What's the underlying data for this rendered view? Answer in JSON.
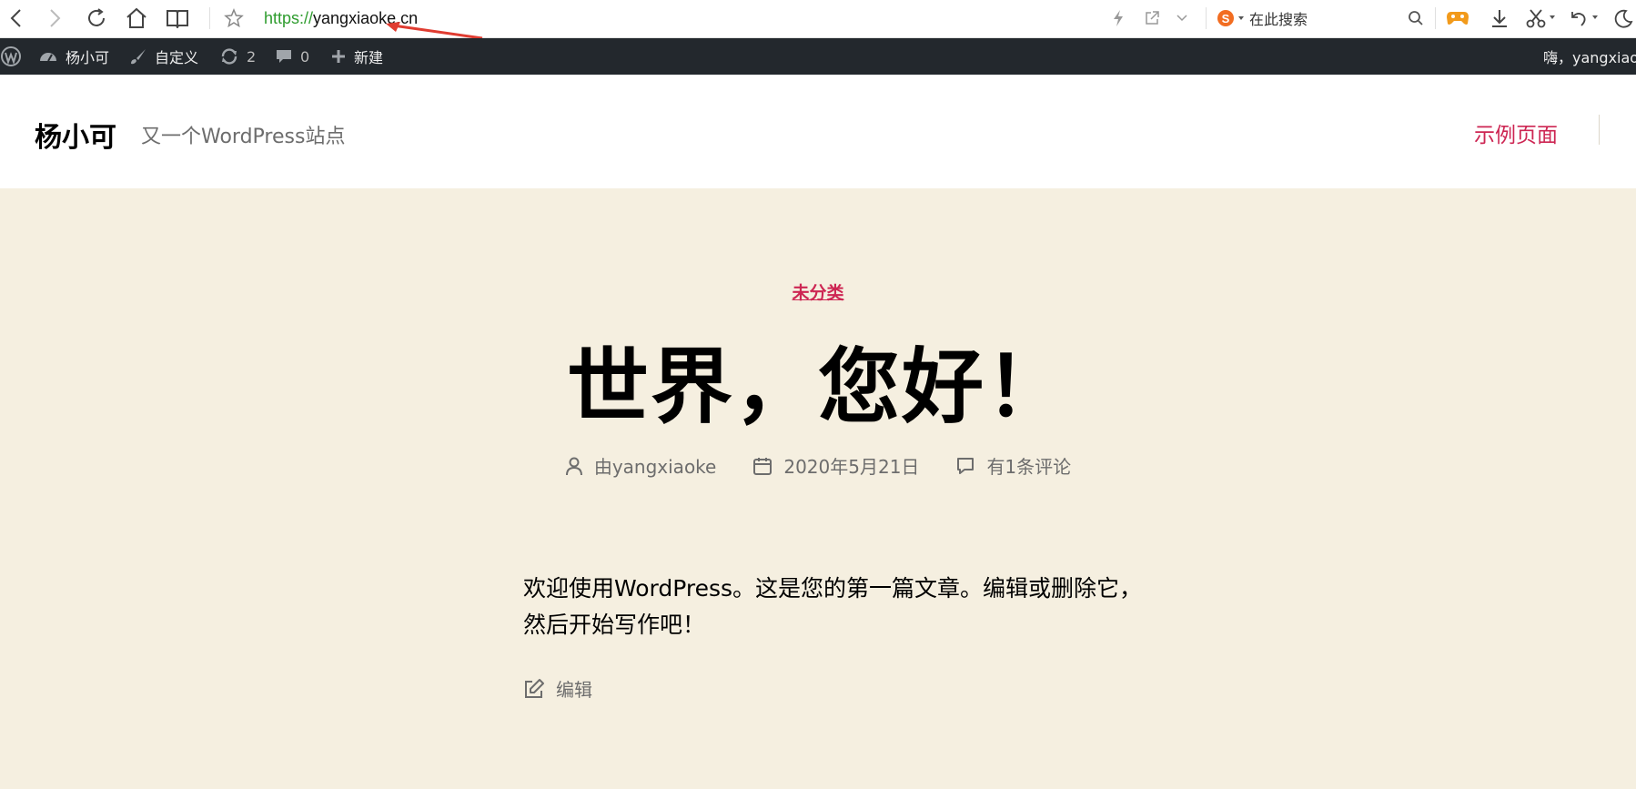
{
  "browser": {
    "url_scheme": "https://",
    "url_host": "yangxiaoke.cn",
    "search_placeholder": "在此搜索"
  },
  "admin_bar": {
    "site_name": "杨小可",
    "customize": "自定义",
    "updates_count": "2",
    "comments_count": "0",
    "new": "新建",
    "greeting": "嗨，yangxiaok"
  },
  "header": {
    "site_title": "杨小可",
    "site_description": "又一个WordPress站点",
    "menu_item": "示例页面"
  },
  "post": {
    "category": "未分类",
    "title": "世界，您好！",
    "author": "由yangxiaoke",
    "date": "2020年5月21日",
    "comments": "有1条评论",
    "content_line1": "欢迎使用WordPress。这是您的第一篇文章。编辑或删除它，",
    "content_line2": "然后开始写作吧！",
    "edit": "编辑"
  },
  "colors": {
    "accent": "#cd2653",
    "background": "#f5efe0",
    "admin_bar": "#23282d",
    "url_scheme": "#2e9c2e"
  }
}
